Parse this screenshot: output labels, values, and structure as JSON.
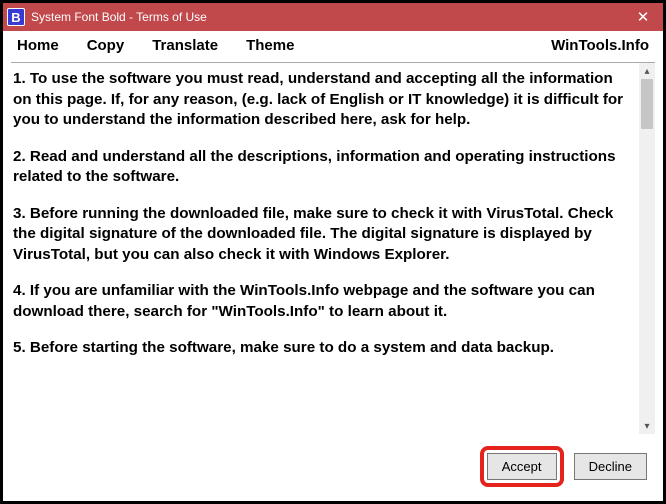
{
  "titlebar": {
    "icon_letter": "B",
    "title": "System Font Bold - Terms of Use"
  },
  "menu": {
    "items": [
      "Home",
      "Copy",
      "Translate",
      "Theme"
    ],
    "brand": "WinTools.Info"
  },
  "terms": {
    "paragraphs": [
      "1. To use the software you must read, understand and accepting all the information on this page. If, for any reason, (e.g. lack of English or IT knowledge) it is difficult for you to understand the information described here, ask for help.",
      "2. Read and understand all the descriptions, information and operating instructions related to the software.",
      "3. Before running the downloaded file, make sure to check it with VirusTotal. Check the digital signature of the downloaded file. The digital signature is displayed by VirusTotal, but you can also check it with Windows Explorer.",
      "4. If you are unfamiliar with the WinTools.Info webpage and the software you can download there, search for \"WinTools.Info\" to learn about it.",
      "5. Before starting the software, make sure to do a system and data backup."
    ]
  },
  "buttons": {
    "accept": "Accept",
    "decline": "Decline"
  }
}
